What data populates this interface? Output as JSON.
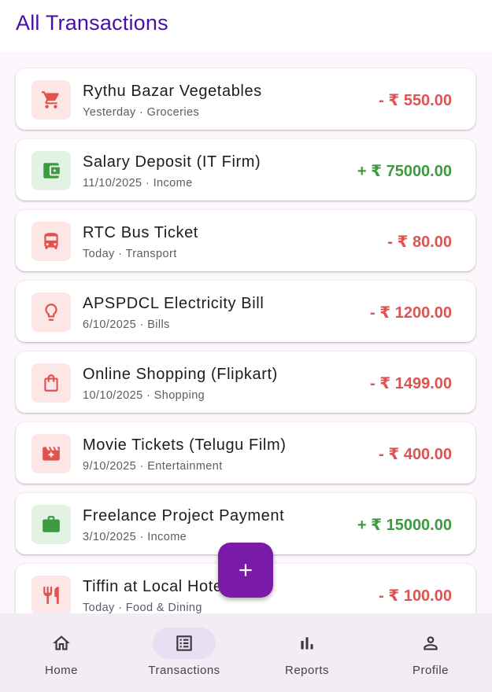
{
  "header": {
    "title": "All Transactions"
  },
  "colors": {
    "expense": "#e05250",
    "income": "#3d9a41",
    "accent": "#7a1aa8",
    "title": "#4a0fa8"
  },
  "transactions": [
    {
      "name": "Rythu Bazar Vegetables",
      "sub": "Yesterday · Groceries",
      "amount": "- ₹ 550.00",
      "type": "expense",
      "icon": "cart-icon"
    },
    {
      "name": "Salary Deposit (IT Firm)",
      "sub": "11/10/2025 · Income",
      "amount": "+ ₹ 75000.00",
      "type": "income",
      "icon": "wallet-icon"
    },
    {
      "name": "RTC Bus Ticket",
      "sub": "Today · Transport",
      "amount": "- ₹ 80.00",
      "type": "expense",
      "icon": "bus-icon"
    },
    {
      "name": "APSPDCL Electricity Bill",
      "sub": "6/10/2025 · Bills",
      "amount": "- ₹ 1200.00",
      "type": "expense",
      "icon": "lightbulb-icon"
    },
    {
      "name": "Online Shopping (Flipkart)",
      "sub": "10/10/2025 · Shopping",
      "amount": "- ₹ 1499.00",
      "type": "expense",
      "icon": "shopping-bag-icon"
    },
    {
      "name": "Movie Tickets (Telugu Film)",
      "sub": "9/10/2025 · Entertainment",
      "amount": "- ₹ 400.00",
      "type": "expense",
      "icon": "movie-icon"
    },
    {
      "name": "Freelance Project Payment",
      "sub": "3/10/2025 · Income",
      "amount": "+ ₹ 15000.00",
      "type": "income",
      "icon": "briefcase-icon"
    },
    {
      "name": "Tiffin at Local Hotel",
      "sub": "Today · Food & Dining",
      "amount": "- ₹ 100.00",
      "type": "expense",
      "icon": "restaurant-icon"
    }
  ],
  "fab": {
    "icon": "plus-icon"
  },
  "nav": {
    "items": [
      {
        "label": "Home",
        "icon": "home-icon"
      },
      {
        "label": "Transactions",
        "icon": "list-icon",
        "active": true
      },
      {
        "label": "Reports",
        "icon": "bar-chart-icon"
      },
      {
        "label": "Profile",
        "icon": "person-icon"
      }
    ]
  }
}
